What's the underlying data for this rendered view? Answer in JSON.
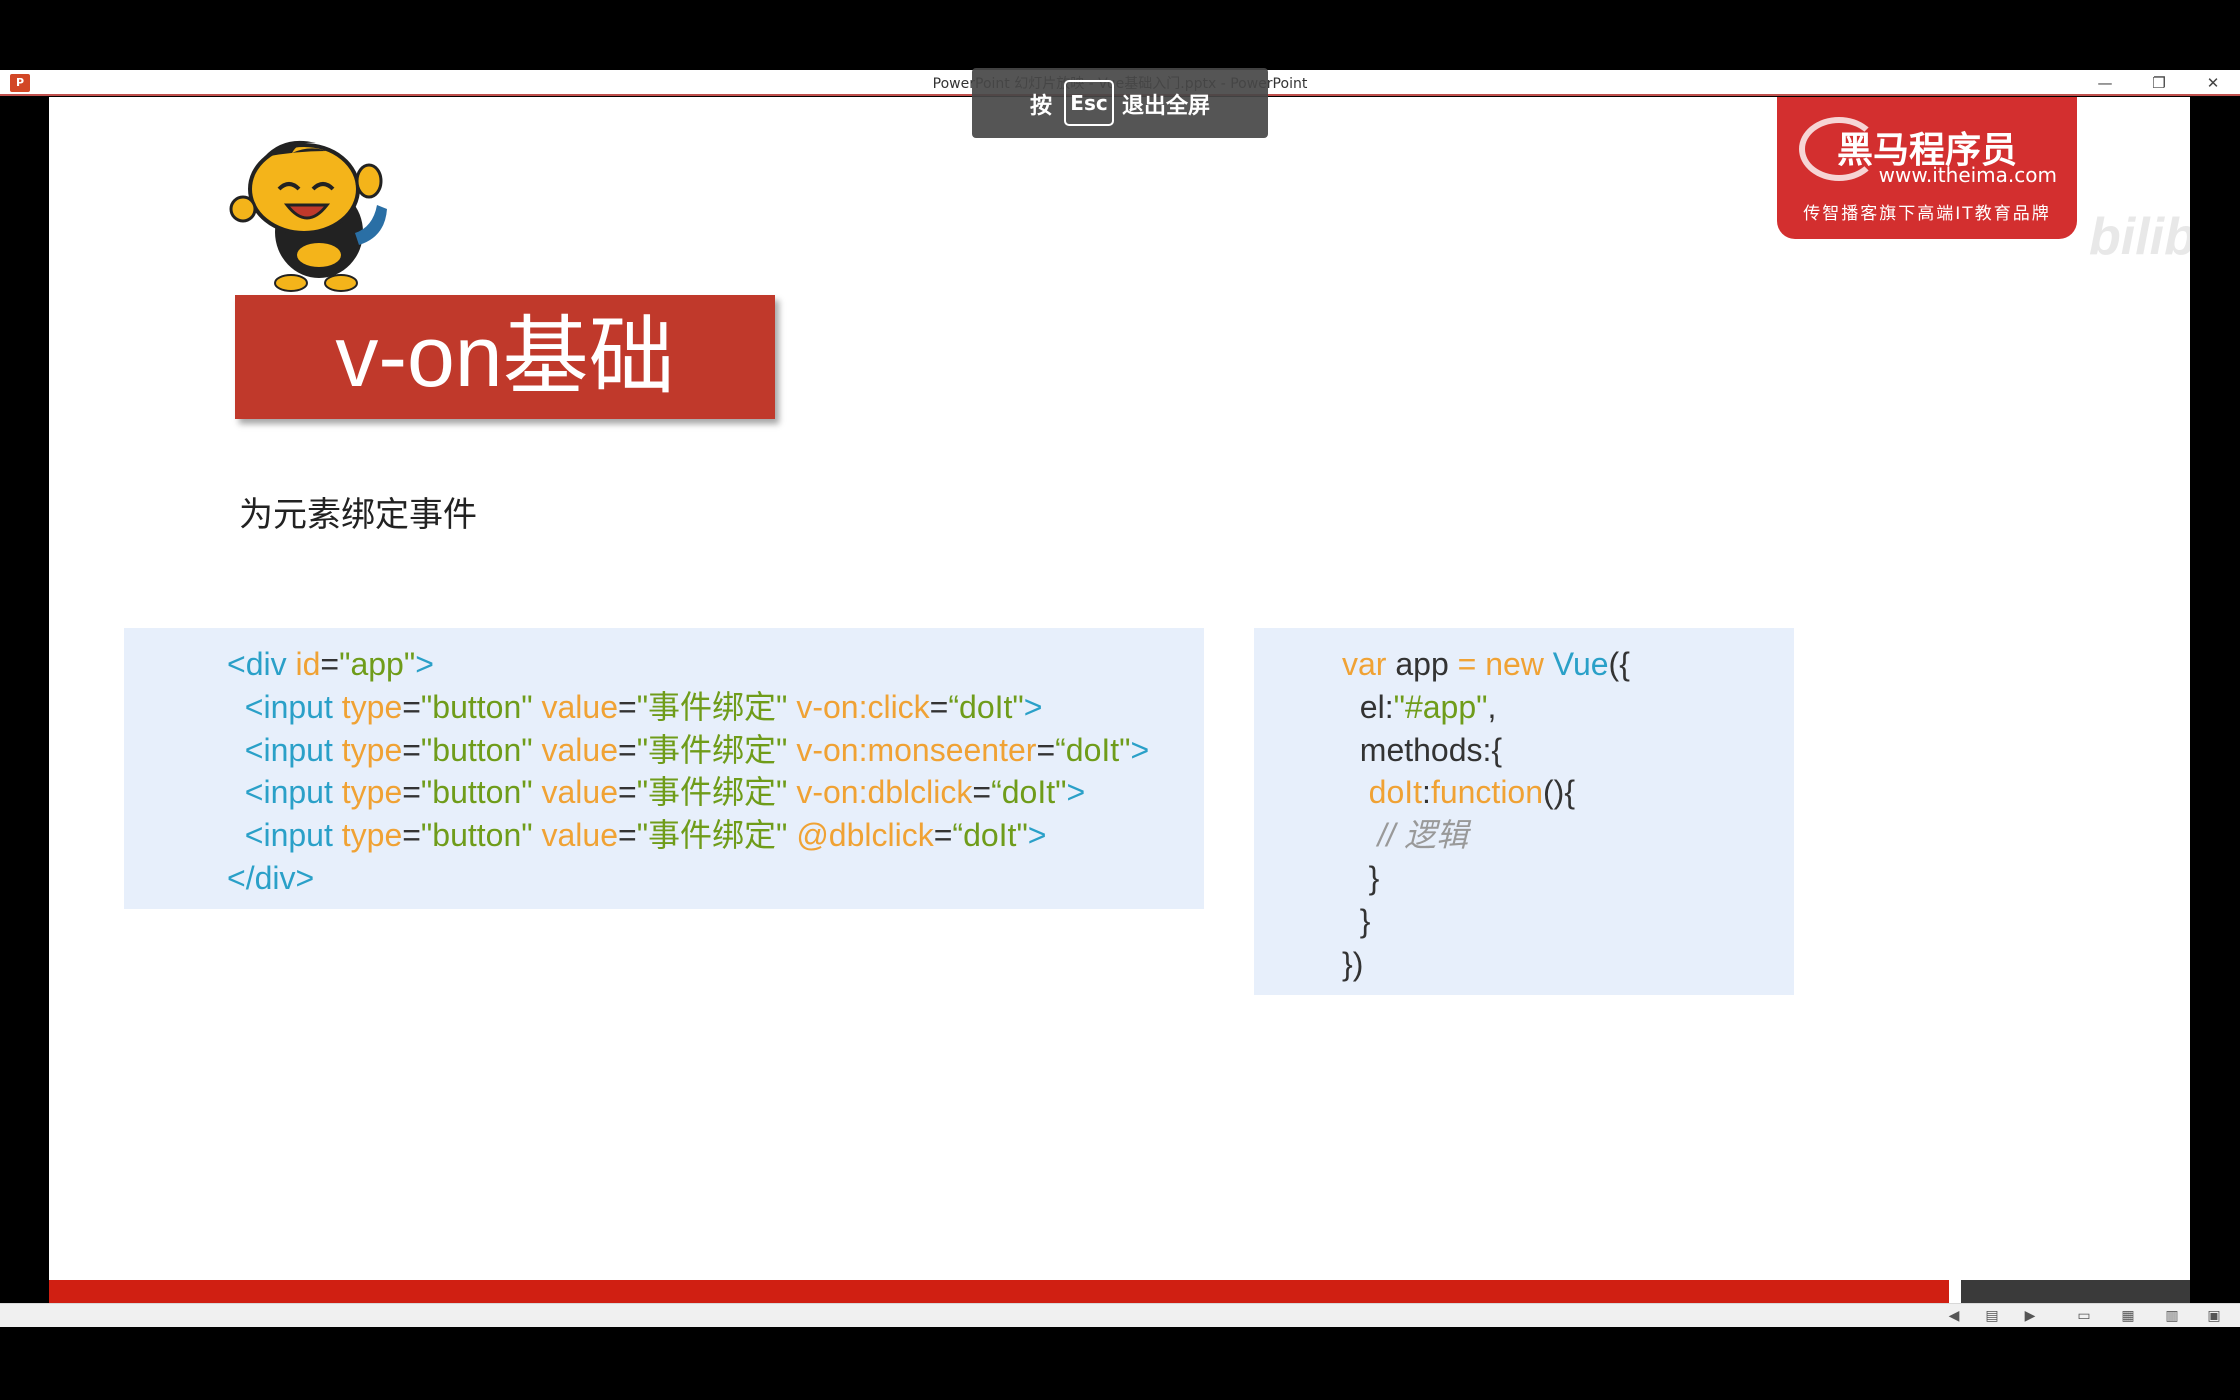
{
  "window": {
    "app_icon": "P",
    "title": "PowerPoint 幻灯片放映 - Vue基础入门.pptx - PowerPoint",
    "minimize": "—",
    "restore": "❐",
    "close": "✕"
  },
  "esc_overlay": {
    "press": "按",
    "key": "Esc",
    "exit": "退出全屏"
  },
  "slide": {
    "title": "v-on基础",
    "subtitle": "为元素绑定事件",
    "logo": {
      "main": "黑马程序员",
      "url": "www.itheima.com",
      "tagline": "传智播客旗下高端IT教育品牌"
    },
    "watermark": "bilibili",
    "html_code": [
      [
        {
          "t": "<div ",
          "c": "tag"
        },
        {
          "t": "id",
          "c": "attr"
        },
        {
          "t": "=",
          "c": "eq"
        },
        {
          "t": "\"app\"",
          "c": "str"
        },
        {
          "t": ">",
          "c": "tag"
        }
      ],
      [
        {
          "t": "  <input ",
          "c": "tag"
        },
        {
          "t": "type",
          "c": "attr"
        },
        {
          "t": "=",
          "c": "eq"
        },
        {
          "t": "\"button\" ",
          "c": "str"
        },
        {
          "t": "value",
          "c": "attr"
        },
        {
          "t": "=",
          "c": "eq"
        },
        {
          "t": "\"事件绑定\" ",
          "c": "str"
        },
        {
          "t": "v-on:click",
          "c": "attr"
        },
        {
          "t": "=",
          "c": "eq"
        },
        {
          "t": "“doIt\"",
          "c": "str"
        },
        {
          "t": ">",
          "c": "tag"
        }
      ],
      [
        {
          "t": "  <input ",
          "c": "tag"
        },
        {
          "t": "type",
          "c": "attr"
        },
        {
          "t": "=",
          "c": "eq"
        },
        {
          "t": "\"button\" ",
          "c": "str"
        },
        {
          "t": "value",
          "c": "attr"
        },
        {
          "t": "=",
          "c": "eq"
        },
        {
          "t": "\"事件绑定\" ",
          "c": "str"
        },
        {
          "t": "v-on:monseenter",
          "c": "attr"
        },
        {
          "t": "=",
          "c": "eq"
        },
        {
          "t": "“doIt\"",
          "c": "str"
        },
        {
          "t": ">",
          "c": "tag"
        }
      ],
      [
        {
          "t": "  <input ",
          "c": "tag"
        },
        {
          "t": "type",
          "c": "attr"
        },
        {
          "t": "=",
          "c": "eq"
        },
        {
          "t": "\"button\" ",
          "c": "str"
        },
        {
          "t": "value",
          "c": "attr"
        },
        {
          "t": "=",
          "c": "eq"
        },
        {
          "t": "\"事件绑定\" ",
          "c": "str"
        },
        {
          "t": "v-on:dblclick",
          "c": "attr"
        },
        {
          "t": "=",
          "c": "eq"
        },
        {
          "t": "“doIt\"",
          "c": "str"
        },
        {
          "t": ">",
          "c": "tag"
        }
      ],
      [
        {
          "t": "  <input ",
          "c": "tag"
        },
        {
          "t": "type",
          "c": "attr"
        },
        {
          "t": "=",
          "c": "eq"
        },
        {
          "t": "\"button\" ",
          "c": "str"
        },
        {
          "t": "value",
          "c": "attr"
        },
        {
          "t": "=",
          "c": "eq"
        },
        {
          "t": "\"事件绑定\" ",
          "c": "str"
        },
        {
          "t": "@dblclick",
          "c": "attr"
        },
        {
          "t": "=",
          "c": "eq"
        },
        {
          "t": "“doIt\"",
          "c": "str"
        },
        {
          "t": ">",
          "c": "tag"
        }
      ],
      [
        {
          "t": "</div>",
          "c": "tag"
        }
      ]
    ],
    "js_code": [
      [
        {
          "t": "var ",
          "c": "kw"
        },
        {
          "t": "app ",
          "c": "plain"
        },
        {
          "t": "= ",
          "c": "kw"
        },
        {
          "t": "new ",
          "c": "kw"
        },
        {
          "t": "Vue",
          "c": "cls"
        },
        {
          "t": "({",
          "c": "plain"
        }
      ],
      [
        {
          "t": "  el:",
          "c": "plain"
        },
        {
          "t": "\"#app\"",
          "c": "str"
        },
        {
          "t": ",",
          "c": "plain"
        }
      ],
      [
        {
          "t": "  methods:{",
          "c": "plain"
        }
      ],
      [
        {
          "t": "   ",
          "c": "plain"
        },
        {
          "t": "doIt",
          "c": "kw"
        },
        {
          "t": ":",
          "c": "plain"
        },
        {
          "t": "function",
          "c": "kw"
        },
        {
          "t": "(){",
          "c": "plain"
        }
      ],
      [
        {
          "t": "    // 逻辑",
          "c": "comment"
        }
      ],
      [
        {
          "t": "   }",
          "c": "plain"
        }
      ],
      [
        {
          "t": "  }",
          "c": "plain"
        }
      ],
      [
        {
          "t": "})",
          "c": "plain"
        }
      ]
    ]
  },
  "statusbar": {
    "prev_icon": "◀",
    "notes_icon": "▤",
    "next_icon": "▶",
    "normal_view_icon": "▭",
    "sorter_view_icon": "▦",
    "reading_view_icon": "▥",
    "slideshow_icon": "▣"
  },
  "colors": {
    "title_bg": "#c0392b",
    "code_bg": "#e7effb",
    "tag": "#2aa0c8",
    "attr": "#f0a234",
    "string": "#6f9c1a",
    "bar_red": "#d01f12"
  }
}
